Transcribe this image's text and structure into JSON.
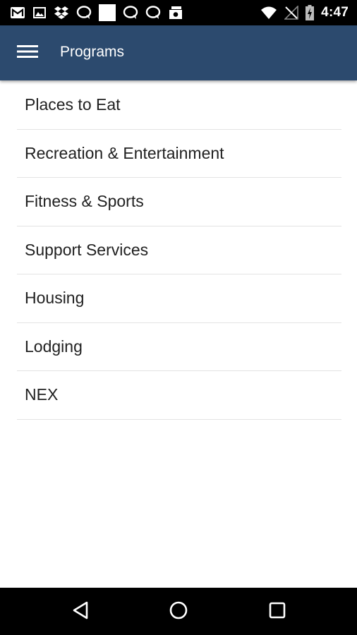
{
  "status_bar": {
    "time": "4:47",
    "left_icons": [
      "gmail-icon",
      "gallery-icon",
      "dropbox-icon",
      "chat-bubble-icon",
      "white-square-icon",
      "chat-bubble-icon",
      "chat-bubble-icon",
      "photo-stack-icon"
    ],
    "right_icons": [
      "wifi-icon",
      "no-signal-icon",
      "battery-charging-icon"
    ]
  },
  "app_bar": {
    "title": "Programs",
    "background": "#2c4a6e",
    "menu_icon": "hamburger-menu-icon"
  },
  "programs": [
    {
      "label": "Places to Eat"
    },
    {
      "label": "Recreation & Entertainment"
    },
    {
      "label": "Fitness & Sports"
    },
    {
      "label": "Support Services"
    },
    {
      "label": "Housing"
    },
    {
      "label": "Lodging"
    },
    {
      "label": "NEX"
    }
  ],
  "nav_bar": {
    "buttons": [
      "back-icon",
      "home-icon",
      "recents-icon"
    ]
  }
}
